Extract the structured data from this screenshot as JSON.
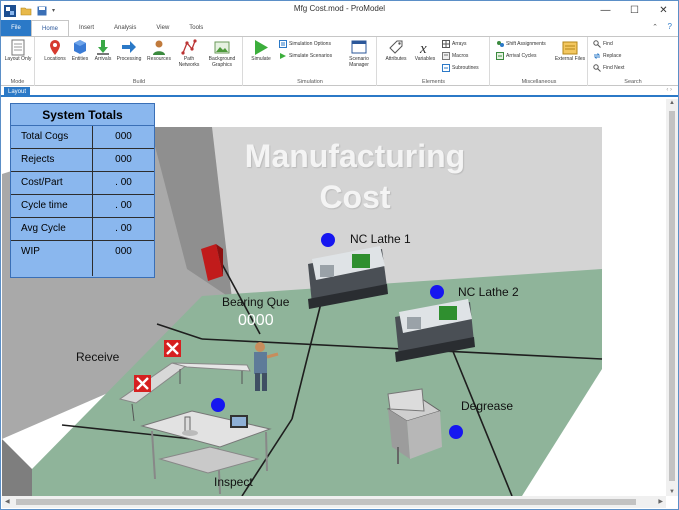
{
  "window": {
    "title": "Mfg Cost.mod - ProModel",
    "minimize": "—",
    "maximize": "☐",
    "close": "✕"
  },
  "ribbon_tabs": [
    "File",
    "Home",
    "Insert",
    "Analysis",
    "View",
    "Tools"
  ],
  "ribbon_help": "?",
  "ribbon_collapse": "⌃",
  "ribbon": {
    "mode": {
      "label": "Mode",
      "layout_only": "Layout Only"
    },
    "build": {
      "label": "Build",
      "items": [
        "Locations",
        "Entities",
        "Arrivals",
        "Processing",
        "Resources",
        "Path Networks",
        "Background Graphics"
      ]
    },
    "simulation": {
      "label": "Simulation",
      "simulate": "Simulate",
      "options": "Simulation Options",
      "scenarios": "Simulate Scenarios",
      "manager": "Scenario Manager"
    },
    "elements": {
      "label": "Elements",
      "attributes": "Attributes",
      "variables": "Variables",
      "arrays": "Arrays",
      "macros": "Macros",
      "subroutines": "Subroutines"
    },
    "misc": {
      "label": "Miscellaneous",
      "shift": "Shift Assignments",
      "arrival_cycles": "Arrival Cycles",
      "external_files": "External Files"
    },
    "search": {
      "label": "Search",
      "find": "Find",
      "replace": "Replace",
      "find_next": "Find Next"
    }
  },
  "doc_tab": "Layout",
  "doc_tab_arrows": "‹ ›",
  "totals": {
    "title": "System Totals",
    "rows": [
      {
        "label": "Total Cogs",
        "value": "000"
      },
      {
        "label": "Rejects",
        "value": "000"
      },
      {
        "label": "Cost/Part",
        "value": ". 00"
      },
      {
        "label": "Cycle time",
        "value": ". 00"
      },
      {
        "label": "Avg Cycle",
        "value": ". 00"
      },
      {
        "label": "WIP",
        "value": "000"
      }
    ]
  },
  "layout": {
    "banner_line1": "Manufacturing",
    "banner_line2": "Cost",
    "nc_lathe_1": "NC Lathe 1",
    "nc_lathe_2": "NC Lathe 2",
    "bearing_que": "Bearing Que",
    "bearing_count": "0000",
    "receive": "Receive",
    "degrease": "Degrease",
    "inspect": "Inspect"
  },
  "colors": {
    "accent": "#2b79c7",
    "totals_bg": "#8ab7ee",
    "floor": "#8fb49a",
    "wall_dark": "#a8a8a8",
    "wall_light": "#cfcfcf",
    "status_dot": "#1616f0"
  }
}
